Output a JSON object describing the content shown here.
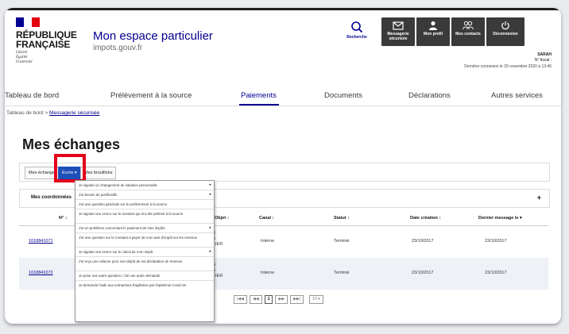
{
  "brand": {
    "republique": "RÉPUBLIQUE",
    "francaise": "FRANÇAISE",
    "motto": [
      "Liberté",
      "Égalité",
      "Fraternité"
    ],
    "app_title_a": "Mon espace",
    "app_title_b": "particulier",
    "app_url": "impots.gouv.fr",
    "flag_colors": [
      "#000091",
      "#ffffff",
      "#e1000f"
    ]
  },
  "toolbar": {
    "search_label": "Recherche",
    "messaging_label": "Messagerie sécurisée",
    "profile_label": "Mon profil",
    "contacts_label": "Mes contacts",
    "logout_label": "Déconnexion"
  },
  "user": {
    "name": "SARAH",
    "fiscal": "N° fiscal :",
    "last_connection": "Dernière connexion le 20 novembre 2020 à 13:46"
  },
  "nav": {
    "items": [
      "Tableau de bord",
      "Prélèvement à la source",
      "Paiements",
      "Documents",
      "Déclarations",
      "Autres services"
    ],
    "active": "Paiements"
  },
  "breadcrumb": {
    "home": "Tableau de bord",
    "separator": ">",
    "current": "Messagerie sécurisée"
  },
  "page_title": "Mes échanges",
  "tabs": {
    "items": [
      "Mes échanges",
      "Écrire",
      "Mes brouillons"
    ],
    "active": "Écrire"
  },
  "coordinates": {
    "label": "Mes coordonnées",
    "toggle": "+"
  },
  "table": {
    "headers": [
      "N° ↕",
      "Objet ↕",
      "Canal ↕",
      "Statut ↕",
      "Date création ↕",
      "Dernier message le ▾"
    ],
    "rows": [
      {
        "num": "1018841071",
        "subject": [
          "CE",
          "TS",
          "ULIER"
        ],
        "canal": "Interne",
        "status": "Terminé",
        "created": "23/10/2017",
        "last": "23/10/2017"
      },
      {
        "num": "1018841072",
        "subject": [
          "CE",
          "TS",
          "ULIER"
        ],
        "canal": "Interne",
        "status": "Terminé",
        "created": "23/10/2017",
        "last": "23/10/2017"
      }
    ]
  },
  "pager": {
    "first": "|◀◀",
    "prev": "◀◀",
    "current": "1",
    "next": "▶▶",
    "last": "▶▶|",
    "per_page": "10 ▾"
  },
  "write_menu": {
    "items": [
      {
        "label": "Je signale un changement de situation personnelle",
        "submenu": true
      },
      {
        "label": "J'ai besoin de justificatifs",
        "submenu": true
      },
      {
        "label": "J'ai une question générale sur le prélèvement à la source",
        "submenu": false
      },
      {
        "label": "Je signale une erreur sur le montant qui m'a été prélevé à la source",
        "submenu": false
      },
      {
        "label": "J'ai un problème concernant le paiement de mes impôts",
        "submenu": true
      },
      {
        "label": "J'ai une question sur le montant à payer de mon avis d'impôt sur les revenus",
        "submenu": false
      },
      {
        "label": "Je signale une erreur sur le calcul de mon impôt",
        "submenu": true
      },
      {
        "label": "J'ai reçu une relance pour non dépôt de ma déclaration de revenus",
        "submenu": false
      },
      {
        "label": "Je pose une autre question / J'ai une autre demande",
        "submenu": false
      },
      {
        "label": "Je demande l'aide aux entreprises fragilisées par l'épidémie Covid-19",
        "submenu": false
      }
    ]
  }
}
